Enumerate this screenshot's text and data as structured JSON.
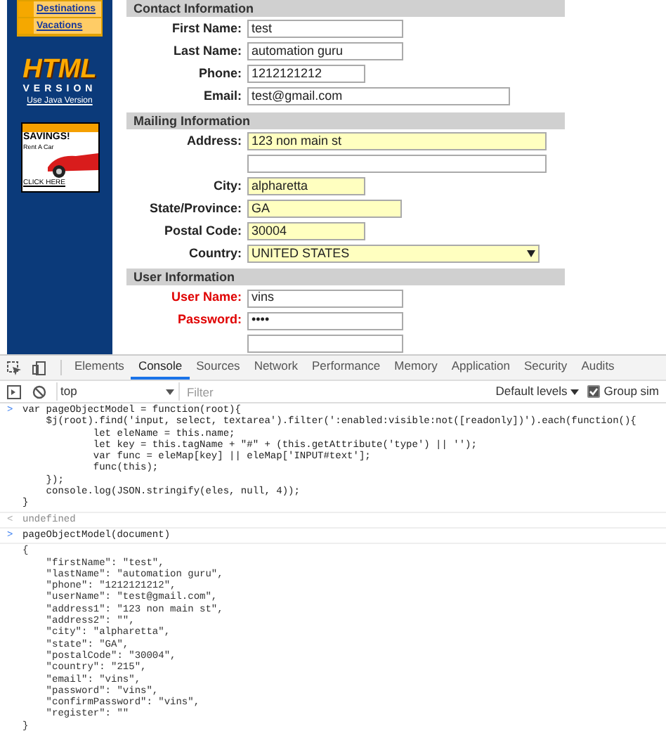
{
  "sidebar": {
    "nav_items": [
      {
        "label": "Destinations"
      },
      {
        "label": "Vacations"
      }
    ],
    "logo": {
      "title": "HTML",
      "subtitle": "VERSION"
    },
    "java_link": "Use Java Version",
    "ad": {
      "headline": "SAVINGS!",
      "tagline": "Rent A Car",
      "link": "CLICK HERE"
    }
  },
  "form": {
    "sections": [
      {
        "title": "Contact Information",
        "fields": [
          {
            "kind": "text",
            "label": "First Name:",
            "value": "test",
            "highlighted": false,
            "required": false
          },
          {
            "kind": "text",
            "label": "Last Name:",
            "value": "automation guru",
            "highlighted": false,
            "required": false
          },
          {
            "kind": "text",
            "label": "Phone:",
            "value": "1212121212",
            "highlighted": false,
            "required": false
          },
          {
            "kind": "text",
            "label": "Email:",
            "value": "test@gmail.com",
            "highlighted": false,
            "required": false
          }
        ]
      },
      {
        "title": "Mailing Information",
        "fields": [
          {
            "kind": "text",
            "label": "Address:",
            "value": "123 non main st",
            "highlighted": true,
            "required": false
          },
          {
            "kind": "text",
            "highlighted": false
          },
          {
            "kind": "text",
            "label": "City:",
            "value": "alpharetta",
            "highlighted": true,
            "required": false
          },
          {
            "kind": "text",
            "label": "State/Province:",
            "value": "GA",
            "highlighted": true,
            "required": false
          },
          {
            "kind": "text",
            "label": "Postal Code:",
            "value": "30004",
            "highlighted": true,
            "required": false
          },
          {
            "kind": "select",
            "label": "Country:",
            "value": "UNITED STATES",
            "highlighted": true,
            "required": false
          }
        ]
      },
      {
        "title": "User Information",
        "fields": [
          {
            "kind": "text",
            "label": "User Name:",
            "value": "vins",
            "highlighted": false,
            "required": true
          },
          {
            "kind": "password",
            "label": "Password:",
            "value": "••••",
            "highlighted": false,
            "required": true
          },
          {
            "kind": "text",
            "highlighted": false
          }
        ]
      }
    ]
  },
  "devtools": {
    "tabs": [
      {
        "label": "Elements",
        "selected": false
      },
      {
        "label": "Console",
        "selected": true
      },
      {
        "label": "Sources",
        "selected": false
      },
      {
        "label": "Network",
        "selected": false
      },
      {
        "label": "Performance",
        "selected": false
      },
      {
        "label": "Memory",
        "selected": false
      },
      {
        "label": "Application",
        "selected": false
      },
      {
        "label": "Security",
        "selected": false
      },
      {
        "label": "Audits",
        "selected": false
      }
    ],
    "context": "top",
    "filter_placeholder": "Filter",
    "levels": "Default levels",
    "group_similar": {
      "label": "Group sim",
      "checked": true
    },
    "console": [
      {
        "kind": "input",
        "prompt": ">",
        "lines": [
          "var pageObjectModel = function(root){",
          "    $j(root).find('input, select, textarea').filter(':enabled:visible:not([readonly])').each(function(){",
          "            let eleName = this.name;",
          "            let key = this.tagName + \"#\" + (this.getAttribute('type') || '');",
          "            var func = eleMap[key] || eleMap['INPUT#text'];",
          "            func(this);",
          "    });",
          "    console.log(JSON.stringify(eles, null, 4));",
          "}"
        ]
      },
      {
        "kind": "result",
        "prompt": "<",
        "lines": [
          "undefined"
        ]
      },
      {
        "kind": "input",
        "prompt": ">",
        "lines": [
          "pageObjectModel(document)"
        ]
      },
      {
        "kind": "output",
        "lines": [
          "{",
          "    \"firstName\": \"test\",",
          "    \"lastName\": \"automation guru\",",
          "    \"phone\": \"1212121212\",",
          "    \"userName\": \"test@gmail.com\",",
          "    \"address1\": \"123 non main st\",",
          "    \"address2\": \"\",",
          "    \"city\": \"alpharetta\",",
          "    \"state\": \"GA\",",
          "    \"postalCode\": \"30004\",",
          "    \"country\": \"215\",",
          "    \"email\": \"vins\",",
          "    \"password\": \"vins\",",
          "    \"confirmPassword\": \"vins\",",
          "    \"register\": \"\"",
          "}"
        ]
      }
    ]
  }
}
